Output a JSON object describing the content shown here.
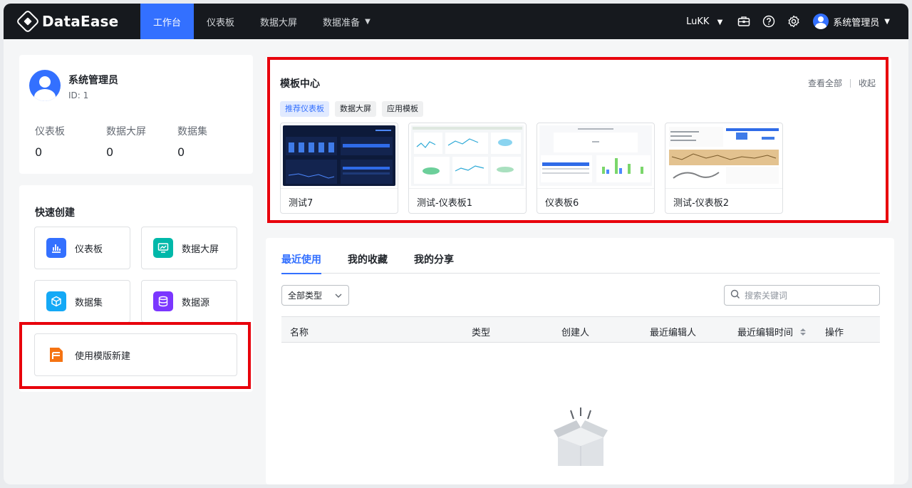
{
  "app": {
    "name": "DataEase"
  },
  "nav": {
    "tabs": [
      {
        "label": "工作台"
      },
      {
        "label": "仪表板"
      },
      {
        "label": "数据大屏"
      },
      {
        "label": "数据准备"
      }
    ],
    "lang": "LuKK",
    "user": "系统管理员"
  },
  "profile": {
    "name": "系统管理员",
    "id": "ID: 1",
    "stats": [
      {
        "label": "仪表板",
        "value": "0"
      },
      {
        "label": "数据大屏",
        "value": "0"
      },
      {
        "label": "数据集",
        "value": "0"
      }
    ]
  },
  "quick_create": {
    "title": "快速创建",
    "items": [
      {
        "label": "仪表板",
        "color": "#3370ff",
        "icon": "bar-chart-icon"
      },
      {
        "label": "数据大屏",
        "color": "#00b8a9",
        "icon": "screen-icon"
      },
      {
        "label": "数据集",
        "color": "#14a9f6",
        "icon": "cube-icon"
      },
      {
        "label": "数据源",
        "color": "#7b36ff",
        "icon": "database-icon"
      },
      {
        "label": "使用模版新建",
        "color": "#f57312",
        "icon": "template-icon"
      }
    ]
  },
  "template_center": {
    "title": "模板中心",
    "view_all": "查看全部",
    "collapse": "收起",
    "chips": [
      "推荐仪表板",
      "数据大屏",
      "应用模板"
    ],
    "templates": [
      {
        "name": "测试7"
      },
      {
        "name": "测试-仪表板1"
      },
      {
        "name": "仪表板6"
      },
      {
        "name": "测试-仪表板2"
      }
    ]
  },
  "recent": {
    "tabs": [
      "最近使用",
      "我的收藏",
      "我的分享"
    ],
    "type_filter": "全部类型",
    "search_placeholder": "搜索关键词",
    "columns": [
      "名称",
      "类型",
      "创建人",
      "最近编辑人",
      "最近编辑时间",
      "操作"
    ]
  },
  "colors": {
    "accent": "#3370ff",
    "nav_bg": "#16191e",
    "highlight": "#e8000b"
  }
}
